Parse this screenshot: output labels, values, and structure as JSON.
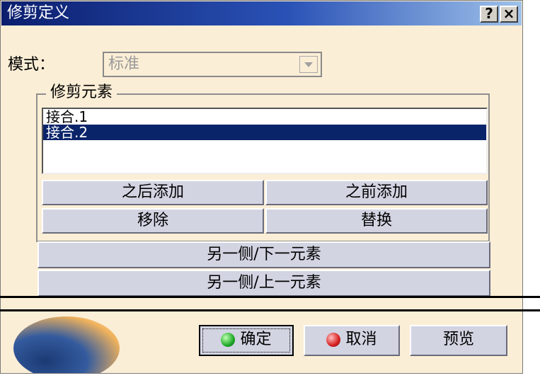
{
  "title": "修剪定义",
  "help_label": "?",
  "close_label": "×",
  "mode": {
    "label": "模式：",
    "value": "标准"
  },
  "group": {
    "title": "修剪元素",
    "items": [
      {
        "label": "接合.1",
        "selected": false
      },
      {
        "label": "接合.2",
        "selected": true
      }
    ]
  },
  "buttons": {
    "add_after": "之后添加",
    "add_before": "之前添加",
    "remove": "移除",
    "replace": "替换",
    "other_side_next": "另一侧/下一元素",
    "other_side_prev": "另一侧/上一元素"
  },
  "footer": {
    "ok": "确定",
    "cancel": "取消",
    "preview": "预览"
  },
  "colors": {
    "title_bar": "#0b1e6e",
    "dialog_bg": "#fbeed6",
    "button_bg": "#d2d4e2",
    "selection": "#0a246a",
    "ok_icon": "#1faa2a",
    "cancel_icon": "#d62020"
  }
}
